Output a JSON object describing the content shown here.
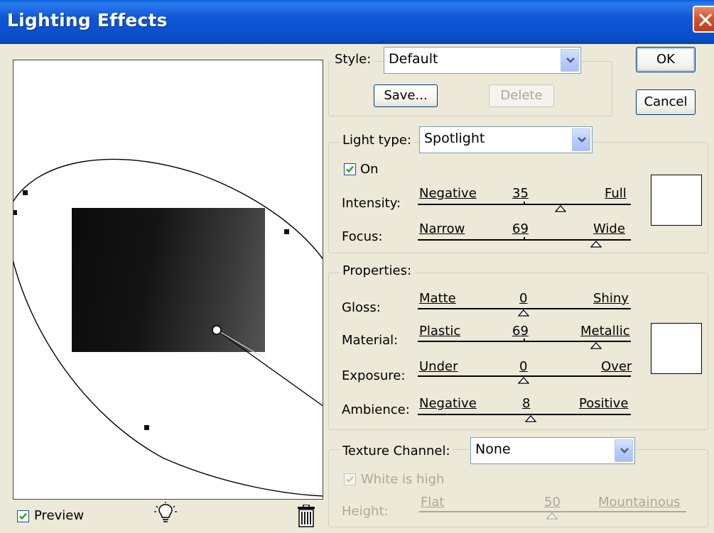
{
  "window": {
    "title": "Lighting Effects"
  },
  "preview": {
    "label": "Preview",
    "checked": true
  },
  "style": {
    "label": "Style:",
    "value": "Default",
    "save_label": "Save...",
    "delete_label": "Delete"
  },
  "buttons": {
    "ok": "OK",
    "cancel": "Cancel"
  },
  "light": {
    "type_label": "Light type:",
    "type_value": "Spotlight",
    "on_label": "On",
    "on_checked": true,
    "intensity": {
      "label": "Intensity:",
      "min": "Negative",
      "max": "Full",
      "value": "35"
    },
    "focus": {
      "label": "Focus:",
      "min": "Narrow",
      "max": "Wide",
      "value": "69"
    },
    "color": "#FFFFFF"
  },
  "properties": {
    "title": "Properties:",
    "gloss": {
      "label": "Gloss:",
      "min": "Matte",
      "max": "Shiny",
      "value": "0"
    },
    "material": {
      "label": "Material:",
      "min": "Plastic",
      "max": "Metallic",
      "value": "69"
    },
    "exposure": {
      "label": "Exposure:",
      "min": "Under",
      "max": "Over",
      "value": "0"
    },
    "ambience": {
      "label": "Ambience:",
      "min": "Negative",
      "max": "Positive",
      "value": "8"
    },
    "color": "#FFFFFF"
  },
  "texture": {
    "label": "Texture Channel:",
    "value": "None",
    "white_is_high": "White is high",
    "height": {
      "label": "Height:",
      "min": "Flat",
      "max": "Mountainous",
      "value": "50"
    }
  },
  "icons": {
    "new_light": "lightbulb-icon",
    "delete_light": "trash-icon",
    "close": "close-icon",
    "dropdown": "chevron-down-icon"
  },
  "colors": {
    "titlebar": "#0A4FCB",
    "close": "#C23E1C",
    "face": "#ECE9D8",
    "check": "#21A121"
  }
}
